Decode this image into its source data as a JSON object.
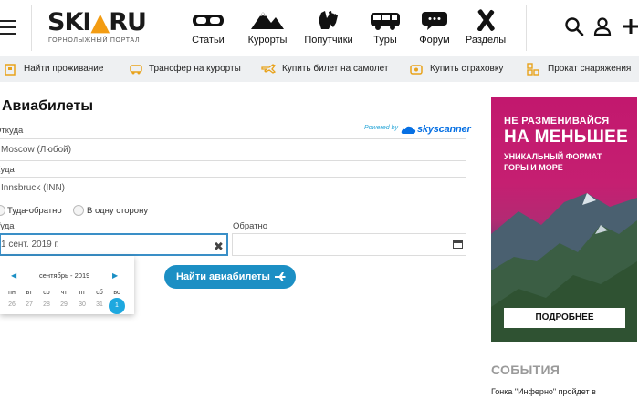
{
  "header": {
    "logo_part1": "SKI",
    "logo_part2": "▲",
    "logo_part3": "RU",
    "logo_subtitle": "ГОРНОЛЫЖНЫЙ ПОРТАЛ",
    "nav": [
      {
        "label": "Статьи",
        "icon": "goggles-icon"
      },
      {
        "label": "Курорты",
        "icon": "mountains-icon"
      },
      {
        "label": "Попутчики",
        "icon": "gloves-icon"
      },
      {
        "label": "Туры",
        "icon": "bus-icon"
      },
      {
        "label": "Форум",
        "icon": "chat-bubble-icon"
      },
      {
        "label": "Разделы",
        "icon": "skis-icon"
      }
    ]
  },
  "subnav": [
    {
      "label": "Найти проживание",
      "icon": "hotel-icon"
    },
    {
      "label": "Трансфер на курорты",
      "icon": "transfer-icon"
    },
    {
      "label": "Купить билет на самолет",
      "icon": "plane-icon"
    },
    {
      "label": "Купить страховку",
      "icon": "insurance-icon"
    },
    {
      "label": "Прокат снаряжения",
      "icon": "rental-icon"
    }
  ],
  "form": {
    "title": "Авиабилеты",
    "from_label": "Откуда",
    "from_value": "Moscow (Любой)",
    "to_label": "Куда",
    "to_value": "Innsbruck (INN)",
    "powered_by": "Powered by",
    "skyscanner": "skyscanner",
    "radio_round": "Туда-обратно",
    "radio_oneway": "В одну сторону",
    "depart_label": "Туда",
    "depart_value": "1 сент. 2019 г.",
    "return_label": "Обратно",
    "return_value": "",
    "clear_symbol": "✖",
    "search_button": "Найти авиабилеты"
  },
  "datepicker": {
    "prev": "◀",
    "next": "▶",
    "month": "сентябрь - 2019",
    "weekdays": [
      "пн",
      "вт",
      "ср",
      "чт",
      "пт",
      "сб",
      "вс"
    ],
    "days": [
      "26",
      "27",
      "28",
      "29",
      "30",
      "31"
    ],
    "selected_day": "1"
  },
  "ad": {
    "line1": "НЕ РАЗМЕНИВАЙСЯ",
    "line2": "НА МЕНЬШЕЕ",
    "line3": "УНИКАЛЬНЫЙ ФОРМАТ",
    "line4": "ГОРЫ И МОРЕ",
    "button": "ПОДРОБНЕЕ"
  },
  "events": {
    "title": "СОБЫТИЯ",
    "item": "Гонка \"Инферно\" пройдет в"
  },
  "colors": {
    "accent": "#1c8fc4",
    "selected_day": "#1ea8df",
    "subnav_bg": "#eef0f2",
    "ad_pink": "#c2186e"
  }
}
